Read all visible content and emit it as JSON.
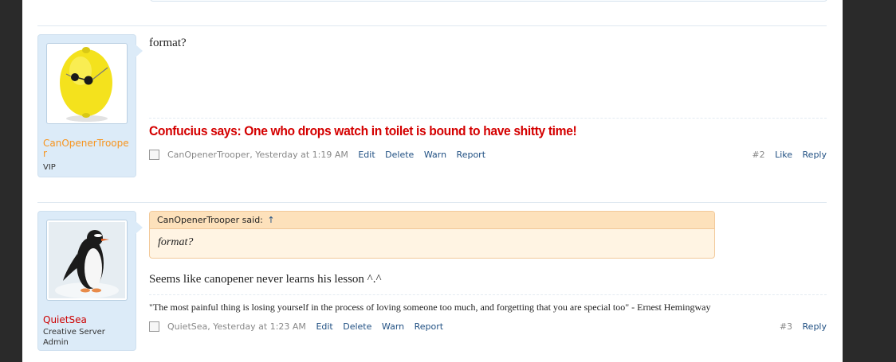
{
  "posts": [
    {
      "username": "CanOpenerTrooper",
      "user_title": "VIP",
      "avatar_icon": "lemon-with-sunglasses",
      "message": "format?",
      "signature": "Confucius says: One who drops watch in toilet is bound to have shitty time!",
      "author": "CanOpenerTrooper",
      "time": "Yesterday at 1:19 AM",
      "actions": [
        "Edit",
        "Delete",
        "Warn",
        "Report"
      ],
      "post_number": "#2",
      "like_label": "Like",
      "reply_label": "Reply"
    },
    {
      "username": "QuietSea",
      "user_title_1": "Creative Server",
      "user_title_2": "Admin",
      "avatar_icon": "penguin",
      "quote_author": "CanOpenerTrooper said:",
      "quote_arrow": "↑",
      "quote_text": "format?",
      "message": "Seems like canopener never learns his lesson ^.^",
      "signature": "\"The most painful thing is losing yourself in the process of loving someone too much, and forgetting that you are special too\" - Ernest Hemingway",
      "author": "QuietSea",
      "time": "Yesterday at 1:23 AM",
      "actions": [
        "Edit",
        "Delete",
        "Warn",
        "Report"
      ],
      "post_number": "#3",
      "reply_label": "Reply"
    }
  ],
  "colors": {
    "username_vip": "#f7941d",
    "username_admin": "#cc0000",
    "signature_red": "#d40000",
    "link": "#1f4f82"
  }
}
